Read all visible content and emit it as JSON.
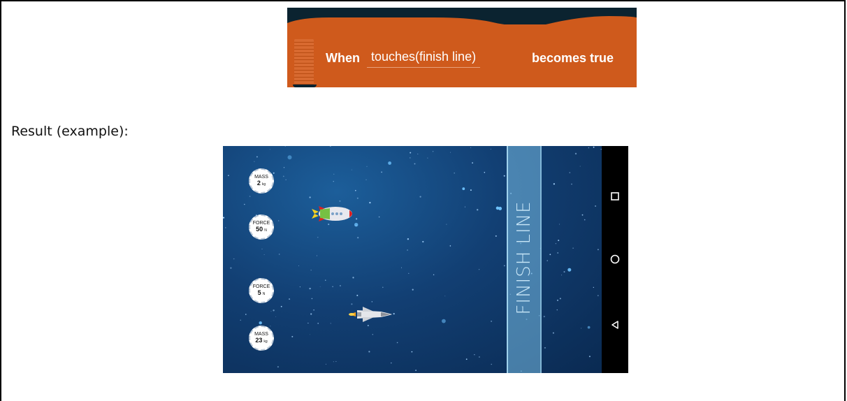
{
  "block": {
    "when_label": "When",
    "condition": "touches(finish line)",
    "becomes_label": "becomes true",
    "color": "#cf5a1c"
  },
  "result_label": "Result (example):",
  "game": {
    "finish_label": "FINISH LINE",
    "badges": [
      {
        "label": "MASS",
        "value": "2",
        "unit": "kg"
      },
      {
        "label": "FORCE",
        "value": "50",
        "unit": "N"
      },
      {
        "label": "FORCE",
        "value": "5",
        "unit": "N"
      },
      {
        "label": "MASS",
        "value": "23",
        "unit": "kg"
      }
    ]
  },
  "navbar": {
    "buttons": [
      "recents-icon",
      "home-icon",
      "back-icon"
    ]
  }
}
